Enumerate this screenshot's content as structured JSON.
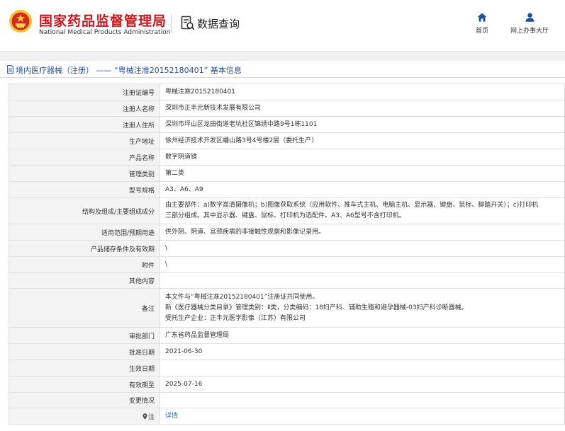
{
  "header": {
    "site_title": "国家药品监督管理局",
    "site_subtitle": "National Medical Products Administration",
    "section_title": "数据查询",
    "nav": [
      {
        "label": "首页",
        "icon": "home-icon"
      },
      {
        "label": "网上办事大厅",
        "icon": "user-icon"
      }
    ],
    "brand_color": "#c8171e"
  },
  "breadcrumb": {
    "text": "境内医疗器械（注册） —— “粤械注准20152180401” 基本信息"
  },
  "rows": [
    {
      "label": "注册证编号",
      "value": "粤械注准20152180401"
    },
    {
      "label": "注册人名称",
      "value": "深圳市正丰元新技术发展有限公司"
    },
    {
      "label": "注册人住所",
      "value": "深圳市坪山区龙田街道老坑社区锦绣中路9号1栋1101"
    },
    {
      "label": "生产地址",
      "value": "徐州经济技术开发区蟠山路3号4号楼2层（委托生产）"
    },
    {
      "label": "产品名称",
      "value": "数字阴道镜"
    },
    {
      "label": "管理类别",
      "value": "第二类"
    },
    {
      "label": "型号规格",
      "value": "A3、A6、A9"
    },
    {
      "label": "结构及组成/主要组成成分",
      "lines": [
        "由主要部件：a)数字高清摄像机；b)图像获取系统（应用软件、推车式主机、电脑主机、显示器、键盘、鼠标、脚踏开关）；c)打印机",
        "三部分组成。其中显示器、键盘、鼠标、打印机为选配件。A3、A6型号不含打印机。"
      ]
    },
    {
      "label": "适用范围/预期用途",
      "value": "供外阴、阴道、宫颈疾病的非接触性观察和影像记录用。"
    },
    {
      "label": "产品储存条件及有效期",
      "value": "\\"
    },
    {
      "label": "附件",
      "value": "\\"
    },
    {
      "label": "其他内容",
      "value": ""
    },
    {
      "label": "备注",
      "lines": [
        "本文件与“粤械注准20152180401”注册证共同使用。",
        "新《医疗器械分类目录》管理类别：Ⅱ类，分类编码：18妇产科、辅助生殖和避孕器械-03妇产科诊断器械。",
        "受托生产企业：正丰元医学影像（江苏）有限公司"
      ]
    },
    {
      "label": "审批部门",
      "value": "广东省药品监督管理局"
    },
    {
      "label": "批准日期",
      "value": "2021-06-30"
    },
    {
      "label": "生效日期",
      "value": ""
    },
    {
      "label": "有效期至",
      "value": "2025-07-16"
    },
    {
      "label": "变更情况",
      "value": ""
    },
    {
      "label": "注",
      "value": "详情"
    }
  ]
}
